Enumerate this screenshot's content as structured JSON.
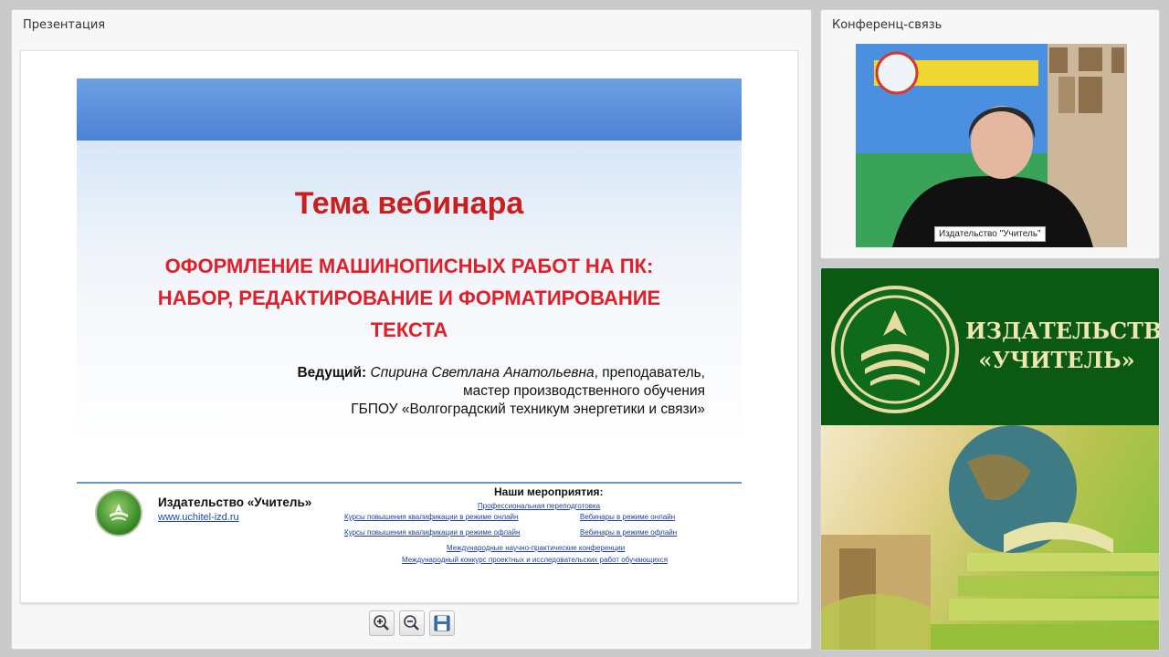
{
  "presentation_panel": {
    "title": "Презентация"
  },
  "conference_panel": {
    "title": "Конференц-связь",
    "video_label": "Издательство \"Учитель\""
  },
  "slide": {
    "topic": "Тема вебинара",
    "theme_lines": [
      "ОФОРМЛЕНИЕ МАШИНОПИСНЫХ РАБОТ НА ПК:",
      "НАБОР, РЕДАКТИРОВАНИЕ И ФОРМАТИРОВАНИЕ",
      "ТЕКСТА"
    ],
    "presenter_label": "Ведущий:",
    "presenter_name": "Спирина Светлана Анатольевна",
    "presenter_role1": ", преподаватель,",
    "presenter_role2": "мастер производственного обучения",
    "presenter_org": "ГБПОУ «Волгоградский техникум энергетики и связи»",
    "footer": {
      "brand": "Издательство «Учитель»",
      "url": "www.uchitel-izd.ru",
      "events_title": "Наши мероприятия:",
      "links": [
        "Профессиональная переподготовка",
        "Курсы повышения квалификации в режиме онлайн",
        "Вебинары в режиме онлайн",
        "Курсы повышения квалификации в режиме офлайн",
        "Вебинары в режиме офлайн",
        "Международные научно-практические конференции",
        "Международный конкурс проектных и исследовательских работ обучающихся"
      ]
    }
  },
  "toolbar": {
    "zoom_in": "zoom-in-icon",
    "zoom_out": "zoom-out-icon",
    "save": "save-icon"
  },
  "promo": {
    "line1": "ИЗДАТЕЛЬСТВО",
    "line2": "«УЧИТЕЛЬ»"
  },
  "colors": {
    "accent_red": "#e01f28",
    "title_red": "#c81f1f",
    "brand_green": "#0a5a14",
    "link_blue": "#1f3fa0"
  }
}
